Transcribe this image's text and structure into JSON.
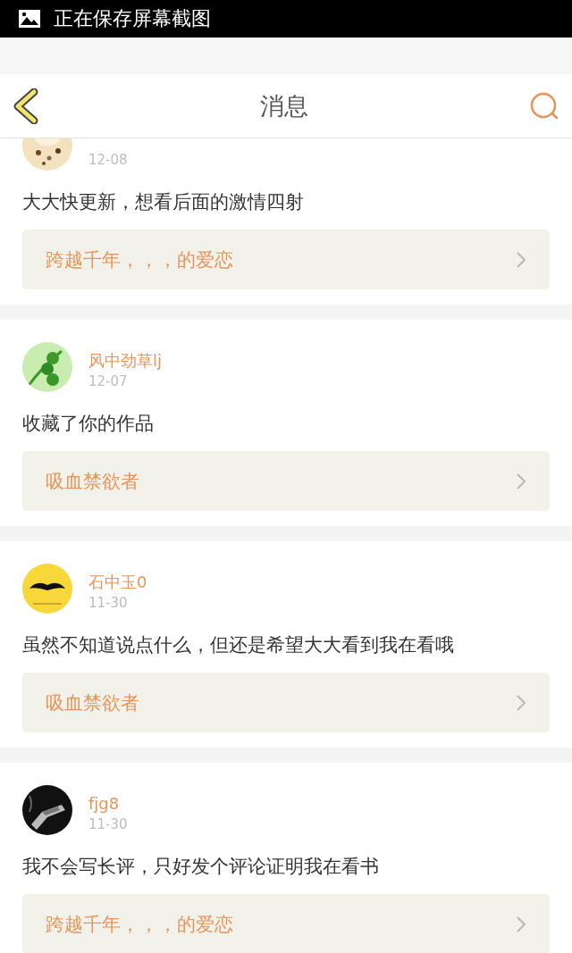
{
  "status_bar": {
    "text": "正在保存屏幕截图"
  },
  "header": {
    "title": "消息"
  },
  "messages": [
    {
      "date": "12-08",
      "text": "大大快更新，想看后面的激情四射",
      "work": "跨越千年，，，的爱恋"
    },
    {
      "name": "风中劲草lj",
      "date": "12-07",
      "text": "收藏了你的作品",
      "work": "吸血禁欲者"
    },
    {
      "name": "石中玉0",
      "date": "11-30",
      "text": "虽然不知道说点什么，但还是希望大大看到我在看哦",
      "work": "吸血禁欲者"
    },
    {
      "name": "fjg8",
      "date": "11-30",
      "text": "我不会写长评，只好发个评论证明我在看书",
      "work": "跨越千年，，，的爱恋"
    }
  ]
}
